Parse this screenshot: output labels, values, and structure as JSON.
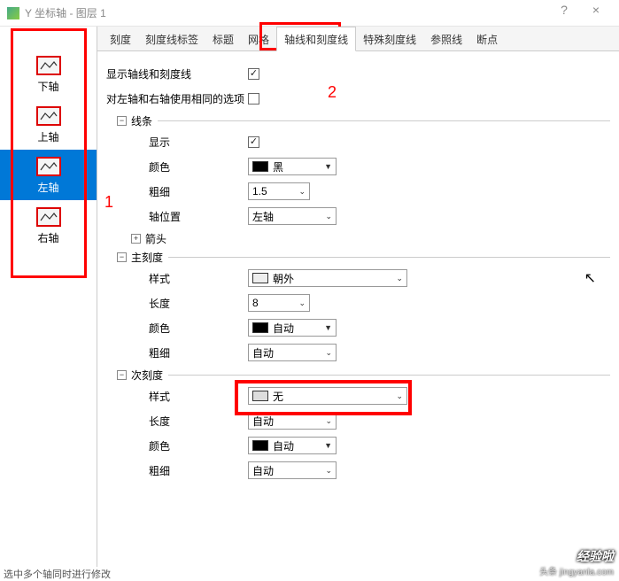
{
  "window": {
    "title": "Y 坐标轴 - 图层 1",
    "help": "?",
    "close": "×"
  },
  "sidebar": {
    "items": [
      {
        "label": "下轴"
      },
      {
        "label": "上轴"
      },
      {
        "label": "左轴"
      },
      {
        "label": "右轴"
      }
    ],
    "selected": 2
  },
  "tabs": {
    "items": [
      "刻度",
      "刻度线标签",
      "标题",
      "网格",
      "轴线和刻度线",
      "特殊刻度线",
      "参照线",
      "断点"
    ],
    "active": 4
  },
  "annotations": {
    "one": "1",
    "two": "2"
  },
  "form": {
    "show_axes_ticks_label": "显示轴线和刻度线",
    "use_same_lr_label": "对左轴和右轴使用相同的选项",
    "line_group": "线条",
    "line_show": "显示",
    "line_color": "颜色",
    "line_color_val": "黑",
    "line_thick": "粗细",
    "line_thick_val": "1.5",
    "axis_pos": "轴位置",
    "axis_pos_val": "左轴",
    "arrow_group": "箭头",
    "major_group": "主刻度",
    "major_style": "样式",
    "major_style_val": "朝外",
    "major_len": "长度",
    "major_len_val": "8",
    "major_color": "颜色",
    "major_color_val": "自动",
    "major_thick": "粗细",
    "major_thick_val": "自动",
    "minor_group": "次刻度",
    "minor_style": "样式",
    "minor_style_val": "无",
    "minor_len": "长度",
    "minor_len_val": "自动",
    "minor_color": "颜色",
    "minor_color_val": "自动",
    "minor_thick": "粗细",
    "minor_thick_val": "自动"
  },
  "footer": "选中多个轴同时进行修改",
  "watermark": {
    "main": "经验啦",
    "sub": "头条 jingyanla.com"
  }
}
